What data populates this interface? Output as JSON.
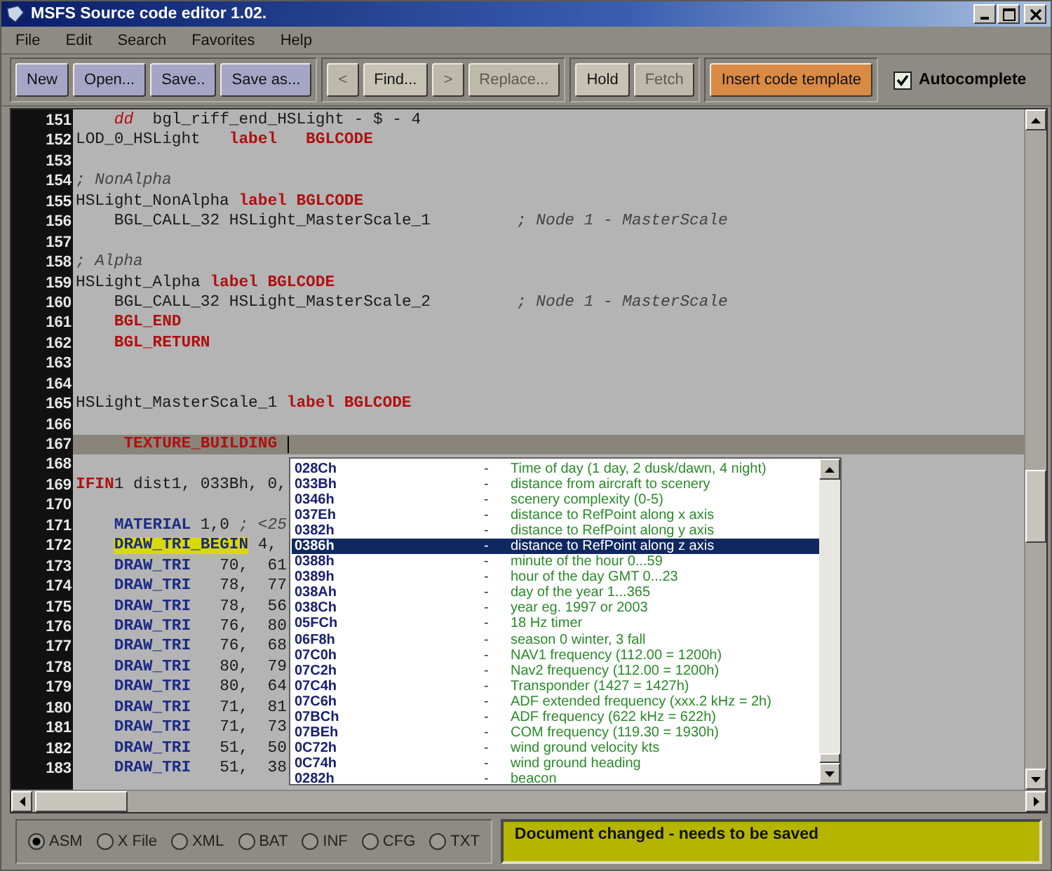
{
  "window": {
    "title": "MSFS Source code editor 1.02."
  },
  "menu": [
    "File",
    "Edit",
    "Search",
    "Favorites",
    "Help"
  ],
  "toolbar": {
    "groups": [
      [
        {
          "label": "New",
          "kind": "file",
          "disabled": false
        },
        {
          "label": "Open...",
          "kind": "file",
          "disabled": false
        },
        {
          "label": "Save..",
          "kind": "file",
          "disabled": false
        },
        {
          "label": "Save as...",
          "kind": "file",
          "disabled": false
        }
      ],
      [
        {
          "label": "<",
          "kind": "plain",
          "disabled": true
        },
        {
          "label": "Find...",
          "kind": "plain",
          "disabled": false
        },
        {
          "label": ">",
          "kind": "plain",
          "disabled": true
        },
        {
          "label": "Replace...",
          "kind": "plain",
          "disabled": true
        }
      ],
      [
        {
          "label": "Hold",
          "kind": "plain",
          "disabled": false
        },
        {
          "label": "Fetch",
          "kind": "plain",
          "disabled": true
        }
      ],
      [
        {
          "label": "Insert code template",
          "kind": "template",
          "disabled": false
        }
      ]
    ],
    "autocomplete": {
      "label": "Autocomplete",
      "checked": true
    }
  },
  "editor": {
    "lines": [
      {
        "number": "151",
        "current": false,
        "indent": true,
        "segments": [
          {
            "text": "dd",
            "kind": "dd"
          },
          {
            "text": "  bgl_riff_end_HSLight - $ - 4",
            "kind": "plain"
          }
        ]
      },
      {
        "number": "152",
        "current": false,
        "segments": [
          {
            "text": "LOD_0_HSLight   ",
            "kind": "plain"
          },
          {
            "text": "label   BGLCODE",
            "kind": "keyword"
          }
        ]
      },
      {
        "number": "153",
        "current": false
      },
      {
        "number": "154",
        "current": false,
        "segments": [
          {
            "text": "; NonAlpha",
            "kind": "comment"
          }
        ]
      },
      {
        "number": "155",
        "current": false,
        "segments": [
          {
            "text": "HSLight_NonAlpha ",
            "kind": "plain"
          },
          {
            "text": "label BGLCODE",
            "kind": "keyword"
          }
        ]
      },
      {
        "number": "156",
        "current": false,
        "indent": true,
        "segments": [
          {
            "text": "BGL_CALL_32 HSLight_MasterScale_1         ",
            "kind": "plain"
          },
          {
            "text": "; Node 1 - MasterScale",
            "kind": "comment"
          }
        ]
      },
      {
        "number": "157",
        "current": false
      },
      {
        "number": "158",
        "current": false,
        "segments": [
          {
            "text": "; Alpha",
            "kind": "comment"
          }
        ]
      },
      {
        "number": "159",
        "current": false,
        "segments": [
          {
            "text": "HSLight_Alpha ",
            "kind": "plain"
          },
          {
            "text": "label BGLCODE",
            "kind": "keyword"
          }
        ]
      },
      {
        "number": "160",
        "current": false,
        "indent": true,
        "segments": [
          {
            "text": "BGL_CALL_32 HSLight_MasterScale_2         ",
            "kind": "plain"
          },
          {
            "text": "; Node 1 - MasterScale",
            "kind": "comment"
          }
        ]
      },
      {
        "number": "161",
        "current": false,
        "indent": true,
        "segments": [
          {
            "text": "BGL_END",
            "kind": "keyword"
          }
        ]
      },
      {
        "number": "162",
        "current": false,
        "indent": true,
        "segments": [
          {
            "text": "BGL_RETURN",
            "kind": "keyword"
          }
        ]
      },
      {
        "number": "163",
        "current": false
      },
      {
        "number": "164",
        "current": false
      },
      {
        "number": "165",
        "current": false,
        "segments": [
          {
            "text": "HSLight_MasterScale_1 ",
            "kind": "plain"
          },
          {
            "text": "label BGLCODE",
            "kind": "keyword"
          }
        ]
      },
      {
        "number": "166",
        "current": false
      },
      {
        "number": "167",
        "current": true,
        "indent": true,
        "segments": [
          {
            "text": " TEXTURE_BUILDING",
            "kind": "keyword"
          }
        ]
      },
      {
        "number": "168",
        "current": false
      },
      {
        "number": "169",
        "current": false,
        "segments": [
          {
            "text": "IFIN",
            "kind": "keyword"
          },
          {
            "text": "1 dist1, 033Bh, 0,",
            "kind": "plain"
          }
        ]
      },
      {
        "number": "170",
        "current": false
      },
      {
        "number": "171",
        "current": false,
        "indent": true,
        "segments": [
          {
            "text": "MATERIAL",
            "kind": "directive"
          },
          {
            "text": " 1,0 ",
            "kind": "plain"
          },
          {
            "text": "; <25",
            "kind": "comment"
          }
        ]
      },
      {
        "number": "172",
        "current": false,
        "indent": true,
        "segments": [
          {
            "text": "DRAW_TRI_BEGIN",
            "kind": "highlight"
          },
          {
            "text": " 4,",
            "kind": "plain"
          }
        ]
      },
      {
        "number": "173",
        "current": false,
        "indent": true,
        "segments": [
          {
            "text": "DRAW_TRI",
            "kind": "directive"
          },
          {
            "text": "   70,  61",
            "kind": "plain"
          }
        ]
      },
      {
        "number": "174",
        "current": false,
        "indent": true,
        "segments": [
          {
            "text": "DRAW_TRI",
            "kind": "directive"
          },
          {
            "text": "   78,  77",
            "kind": "plain"
          }
        ]
      },
      {
        "number": "175",
        "current": false,
        "indent": true,
        "segments": [
          {
            "text": "DRAW_TRI",
            "kind": "directive"
          },
          {
            "text": "   78,  56",
            "kind": "plain"
          }
        ]
      },
      {
        "number": "176",
        "current": false,
        "indent": true,
        "segments": [
          {
            "text": "DRAW_TRI",
            "kind": "directive"
          },
          {
            "text": "   76,  80",
            "kind": "plain"
          }
        ]
      },
      {
        "number": "177",
        "current": false,
        "indent": true,
        "segments": [
          {
            "text": "DRAW_TRI",
            "kind": "directive"
          },
          {
            "text": "   76,  68",
            "kind": "plain"
          }
        ]
      },
      {
        "number": "178",
        "current": false,
        "indent": true,
        "segments": [
          {
            "text": "DRAW_TRI",
            "kind": "directive"
          },
          {
            "text": "   80,  79",
            "kind": "plain"
          }
        ]
      },
      {
        "number": "179",
        "current": false,
        "indent": true,
        "segments": [
          {
            "text": "DRAW_TRI",
            "kind": "directive"
          },
          {
            "text": "   80,  64",
            "kind": "plain"
          }
        ]
      },
      {
        "number": "180",
        "current": false,
        "indent": true,
        "segments": [
          {
            "text": "DRAW_TRI",
            "kind": "directive"
          },
          {
            "text": "   71,  81",
            "kind": "plain"
          }
        ]
      },
      {
        "number": "181",
        "current": false,
        "indent": true,
        "segments": [
          {
            "text": "DRAW_TRI",
            "kind": "directive"
          },
          {
            "text": "   71,  73",
            "kind": "plain"
          }
        ]
      },
      {
        "number": "182",
        "current": false,
        "indent": true,
        "segments": [
          {
            "text": "DRAW_TRI",
            "kind": "directive"
          },
          {
            "text": "   51,  50",
            "kind": "plain"
          }
        ]
      },
      {
        "number": "183",
        "current": false,
        "indent": true,
        "segments": [
          {
            "text": "DRAW_TRI",
            "kind": "directive"
          },
          {
            "text": "   51,  38",
            "kind": "plain"
          }
        ]
      }
    ]
  },
  "autocomplete_list": {
    "items": [
      {
        "code": "028Ch",
        "dash": "-",
        "description": "Time of day (1 day, 2 dusk/dawn, 4 night)",
        "selected": false
      },
      {
        "code": "033Bh",
        "dash": "-",
        "description": "distance from aircraft to scenery",
        "selected": false
      },
      {
        "code": "0346h",
        "dash": "-",
        "description": "scenery complexity (0-5)",
        "selected": false
      },
      {
        "code": "037Eh",
        "dash": "-",
        "description": "distance to RefPoint along x axis",
        "selected": false
      },
      {
        "code": "0382h",
        "dash": "-",
        "description": "distance to RefPoint along y axis",
        "selected": false
      },
      {
        "code": "0386h",
        "dash": "-",
        "description": "distance to RefPoint along z axis",
        "selected": true
      },
      {
        "code": "0388h",
        "dash": "-",
        "description": "minute of the hour  0...59",
        "selected": false
      },
      {
        "code": "0389h",
        "dash": "-",
        "description": "hour of the day GMT 0...23",
        "selected": false
      },
      {
        "code": "038Ah",
        "dash": "-",
        "description": "day of the year 1...365",
        "selected": false
      },
      {
        "code": "038Ch",
        "dash": "-",
        "description": "year eg. 1997 or 2003",
        "selected": false
      },
      {
        "code": "05FCh",
        "dash": "-",
        "description": "18 Hz timer",
        "selected": false
      },
      {
        "code": "06F8h",
        "dash": "-",
        "description": "season 0 winter, 3 fall",
        "selected": false
      },
      {
        "code": "07C0h",
        "dash": "-",
        "description": "NAV1 frequency (112.00 = 1200h)",
        "selected": false
      },
      {
        "code": "07C2h",
        "dash": "-",
        "description": "Nav2 frequency (112.00 = 1200h)",
        "selected": false
      },
      {
        "code": "07C4h",
        "dash": "-",
        "description": "Transponder (1427 = 1427h)",
        "selected": false
      },
      {
        "code": "07C6h",
        "dash": "-",
        "description": "ADF extended frequency (xxx.2 kHz = 2h)",
        "selected": false
      },
      {
        "code": "07BCh",
        "dash": "-",
        "description": "ADF frequency (622 kHz = 622h)",
        "selected": false
      },
      {
        "code": "07BEh",
        "dash": "-",
        "description": "COM frequency (119.30 = 1930h)",
        "selected": false
      },
      {
        "code": "0C72h",
        "dash": "-",
        "description": "wind ground velocity kts",
        "selected": false
      },
      {
        "code": "0C74h",
        "dash": "-",
        "description": "wind ground heading",
        "selected": false
      },
      {
        "code": "0282h",
        "dash": "-",
        "description": "beacon",
        "selected": false
      }
    ]
  },
  "file_types": [
    {
      "label": "ASM",
      "selected": true
    },
    {
      "label": "X File",
      "selected": false
    },
    {
      "label": "XML",
      "selected": false
    },
    {
      "label": "BAT",
      "selected": false
    },
    {
      "label": "INF",
      "selected": false
    },
    {
      "label": "CFG",
      "selected": false
    },
    {
      "label": "TXT",
      "selected": false
    }
  ],
  "status": "Document changed - needs to be saved"
}
